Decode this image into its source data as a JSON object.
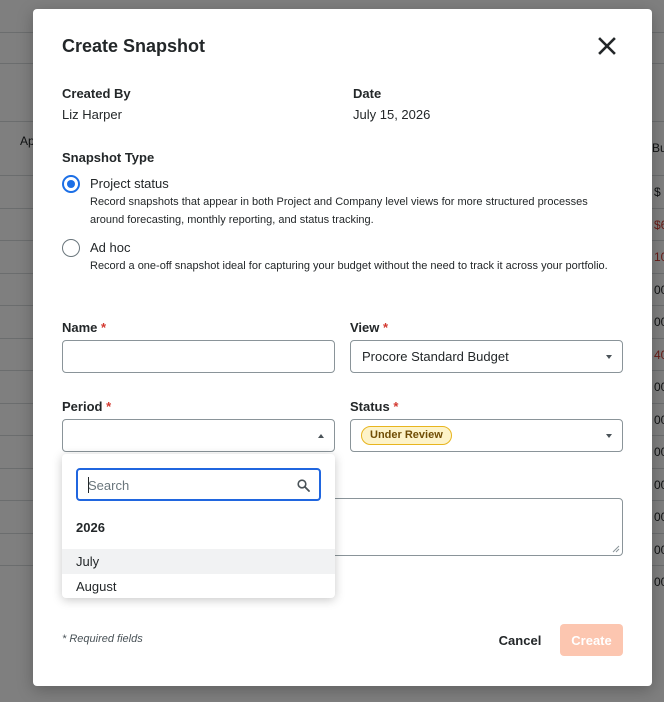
{
  "background": {
    "left_header": "Ap",
    "right_header": "Bu",
    "right_cells": [
      "$",
      "$6",
      "10",
      "00",
      "00",
      "40",
      "00",
      "00",
      "00",
      "00",
      "00",
      "00",
      "00"
    ],
    "right_cell_colors": [
      "#232729",
      "#d3382f",
      "#d3382f",
      "#232729",
      "#232729",
      "#d3382f",
      "#232729",
      "#232729",
      "#232729",
      "#232729",
      "#232729",
      "#232729",
      "#232729"
    ]
  },
  "modal": {
    "title": "Create Snapshot",
    "close_icon": "close-icon",
    "created_by": {
      "label": "Created By",
      "value": "Liz Harper"
    },
    "date": {
      "label": "Date",
      "value": "July 15, 2026"
    },
    "snapshot_type": {
      "label": "Snapshot Type",
      "options": [
        {
          "title": "Project status",
          "description": "Record snapshots that appear in both Project and Company level views for more structured processes around forecasting, monthly reporting, and status tracking.",
          "selected": true
        },
        {
          "title": "Ad hoc",
          "description": "Record a one-off snapshot ideal for capturing your budget without the need to track it across your portfolio.",
          "selected": false
        }
      ]
    },
    "name": {
      "label": "Name",
      "required_mark": "*",
      "value": ""
    },
    "view": {
      "label": "View",
      "required_mark": "*",
      "value": "Procore Standard Budget"
    },
    "period": {
      "label": "Period",
      "required_mark": "*",
      "value": ""
    },
    "status": {
      "label": "Status",
      "required_mark": "*",
      "badge": "Under Review",
      "badge_color": "#fdf3c9"
    },
    "period_menu": {
      "search_placeholder": "Search",
      "search_icon": "search-icon",
      "group": "2026",
      "items": [
        "July",
        "August"
      ],
      "highlighted_item": "July"
    },
    "required_note": "* Required fields",
    "cancel_label": "Cancel",
    "create_label": "Create",
    "accent_color": "#1c6fe6",
    "create_color": "#fcc6b0"
  }
}
